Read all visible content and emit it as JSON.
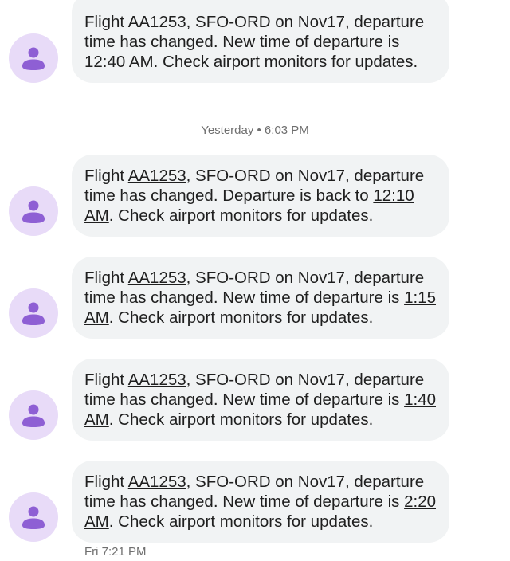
{
  "thread": {
    "divider_timestamp": "Yesterday • 6:03 PM",
    "footer_timestamp": "Fri 7:21 PM",
    "messages": [
      {
        "pre": "Flight ",
        "flight": "AA1253",
        "mid": ", SFO-ORD on Nov17, departure time has changed. New time of departure is ",
        "time": "12:40 AM",
        "post": ". Check airport monitors for updates."
      },
      {
        "pre": "Flight ",
        "flight": "AA1253",
        "mid": ", SFO-ORD on Nov17, departure time has changed. Departure is back to ",
        "time": "12:10 AM",
        "post": ". Check airport monitors for updates."
      },
      {
        "pre": "Flight ",
        "flight": "AA1253",
        "mid": ", SFO-ORD on Nov17, departure time has changed. New time of departure is ",
        "time": "1:15 AM",
        "post": ". Check airport monitors for updates."
      },
      {
        "pre": "Flight ",
        "flight": "AA1253",
        "mid": ", SFO-ORD on Nov17, departure time has changed. New time of departure is ",
        "time": "1:40 AM",
        "post": ". Check airport monitors for updates."
      },
      {
        "pre": "Flight ",
        "flight": "AA1253",
        "mid": ", SFO-ORD on Nov17, departure time has changed. New time of departure is ",
        "time": "2:20 AM",
        "post": ". Check airport monitors for updates."
      }
    ]
  },
  "avatar_icon": "person-icon",
  "colors": {
    "avatar_bg": "#e8dbf8",
    "avatar_fg": "#8e5fd4",
    "bubble_bg": "#f1f3f4",
    "text": "#1f1f1f",
    "timestamp": "#6f6f6f"
  }
}
